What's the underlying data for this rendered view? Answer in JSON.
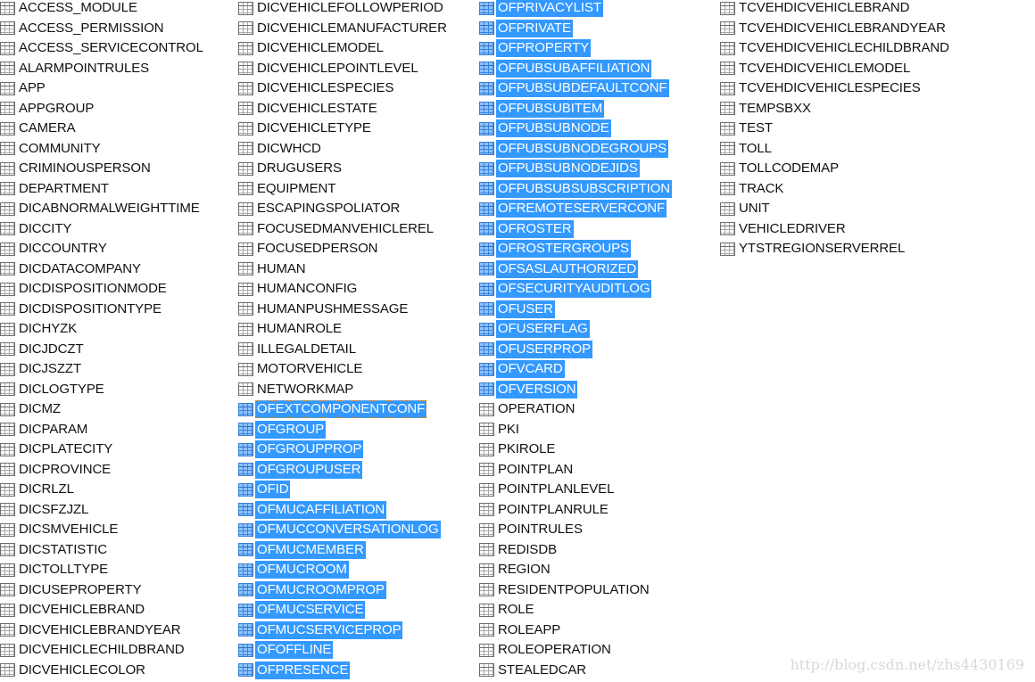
{
  "columns": [
    {
      "items": [
        "ACCESS_MODULE",
        "ACCESS_PERMISSION",
        "ACCESS_SERVICECONTROL",
        "ALARMPOINTRULES",
        "APP",
        "APPGROUP",
        "CAMERA",
        "COMMUNITY",
        "CRIMINOUSPERSON",
        "DEPARTMENT",
        "DICABNORMALWEIGHTTIME",
        "DICCITY",
        "DICCOUNTRY",
        "DICDATACOMPANY",
        "DICDISPOSITIONMODE",
        "DICDISPOSITIONTYPE",
        "DICHYZK",
        "DICJDCZT",
        "DICJSZZT",
        "DICLOGTYPE",
        "DICMZ",
        "DICPARAM",
        "DICPLATECITY",
        "DICPROVINCE",
        "DICRLZL",
        "DICSFZJZL",
        "DICSMVEHICLE",
        "DICSTATISTIC",
        "DICTOLLTYPE",
        "DICUSEPROPERTY",
        "DICVEHICLEBRAND",
        "DICVEHICLEBRANDYEAR",
        "DICVEHICLECHILDBRAND",
        "DICVEHICLECOLOR"
      ],
      "selected_from": -1,
      "selected_to": -1
    },
    {
      "items": [
        "DICVEHICLEFOLLOWPERIOD",
        "DICVEHICLEMANUFACTURER",
        "DICVEHICLEMODEL",
        "DICVEHICLEPOINTLEVEL",
        "DICVEHICLESPECIES",
        "DICVEHICLESTATE",
        "DICVEHICLETYPE",
        "DICWHCD",
        "DRUGUSERS",
        "EQUIPMENT",
        "ESCAPINGSPOLIATOR",
        "FOCUSEDMANVEHICLEREL",
        "FOCUSEDPERSON",
        "HUMAN",
        "HUMANCONFIG",
        "HUMANPUSHMESSAGE",
        "HUMANROLE",
        "ILLEGALDETAIL",
        "MOTORVEHICLE",
        "NETWORKMAP",
        "OFEXTCOMPONENTCONF",
        "OFGROUP",
        "OFGROUPPROP",
        "OFGROUPUSER",
        "OFID",
        "OFMUCAFFILIATION",
        "OFMUCCONVERSATIONLOG",
        "OFMUCMEMBER",
        "OFMUCROOM",
        "OFMUCROOMPROP",
        "OFMUCSERVICE",
        "OFMUCSERVICEPROP",
        "OFOFFLINE",
        "OFPRESENCE"
      ],
      "selected_from": 20,
      "selected_to": 33,
      "focused": 20
    },
    {
      "items": [
        "OFPRIVACYLIST",
        "OFPRIVATE",
        "OFPROPERTY",
        "OFPUBSUBAFFILIATION",
        "OFPUBSUBDEFAULTCONF",
        "OFPUBSUBITEM",
        "OFPUBSUBNODE",
        "OFPUBSUBNODEGROUPS",
        "OFPUBSUBNODEJIDS",
        "OFPUBSUBSUBSCRIPTION",
        "OFREMOTESERVERCONF",
        "OFROSTER",
        "OFROSTERGROUPS",
        "OFSASLAUTHORIZED",
        "OFSECURITYAUDITLOG",
        "OFUSER",
        "OFUSERFLAG",
        "OFUSERPROP",
        "OFVCARD",
        "OFVERSION",
        "OPERATION",
        "PKI",
        "PKIROLE",
        "POINTPLAN",
        "POINTPLANLEVEL",
        "POINTPLANRULE",
        "POINTRULES",
        "REDISDB",
        "REGION",
        "RESIDENTPOPULATION",
        "ROLE",
        "ROLEAPP",
        "ROLEOPERATION",
        "STEALEDCAR"
      ],
      "selected_from": 0,
      "selected_to": 19
    },
    {
      "items": [
        "TCVEHDICVEHICLEBRAND",
        "TCVEHDICVEHICLEBRANDYEAR",
        "TCVEHDICVEHICLECHILDBRAND",
        "TCVEHDICVEHICLEMODEL",
        "TCVEHDICVEHICLESPECIES",
        "TEMPSBXX",
        "TEST",
        "TOLL",
        "TOLLCODEMAP",
        "TRACK",
        "UNIT",
        "VEHICLEDRIVER",
        "YTSTREGIONSERVERREL"
      ],
      "selected_from": -1,
      "selected_to": -1
    }
  ],
  "icon": "table-icon",
  "selection_color": "#3399ff",
  "watermark": "http://blog.csdn.net/zhs4430169"
}
